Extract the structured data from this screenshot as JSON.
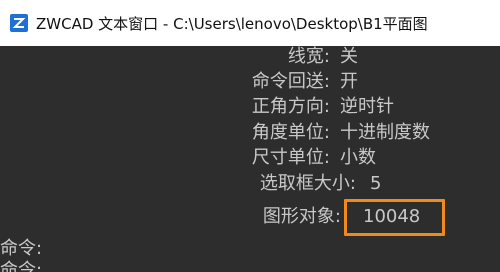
{
  "window": {
    "title": "ZWCAD 文本窗口 - C:\\Users\\lenovo\\Desktop\\B1平面图"
  },
  "settings": [
    {
      "label": "线宽:",
      "value": "关"
    },
    {
      "label": "命令回送:",
      "value": "开"
    },
    {
      "label": "正角方向:",
      "value": "逆时针"
    },
    {
      "label": "角度单位:",
      "value": "十进制度数"
    },
    {
      "label": "尺寸单位:",
      "value": "小数"
    },
    {
      "label": "选取框大小:",
      "value": "5"
    },
    {
      "label": "图形对象:",
      "value": "10048"
    }
  ],
  "prompts": [
    "命令:",
    "命令:"
  ],
  "colors": {
    "background": "#2d2d2d",
    "text": "#c8c8c8",
    "highlight": "#f08a1c"
  }
}
